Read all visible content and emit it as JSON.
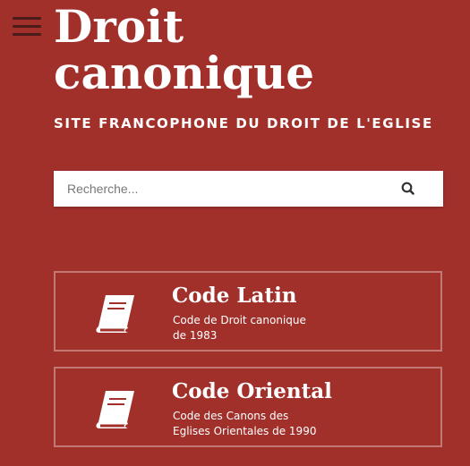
{
  "header": {
    "title_line1": "Droit",
    "title_line2": "canonique",
    "subtitle": "SITE FRANCOPHONE DU DROIT DE L'EGLISE",
    "menu_icon": "hamburger-icon"
  },
  "search": {
    "placeholder": "Recherche...",
    "value": "",
    "icon": "search-icon"
  },
  "cards": [
    {
      "title": "Code Latin",
      "desc_line1": "Code de Droit canonique",
      "desc_line2": "de 1983",
      "icon": "book-icon"
    },
    {
      "title": "Code Oriental",
      "desc_line1": "Code des Canons des",
      "desc_line2": "Eglises Orientales de 1990",
      "icon": "book-icon"
    }
  ],
  "colors": {
    "background": "#a1302b",
    "menu_icon": "#4a1b18",
    "text": "#ffffff",
    "search_bg": "#ffffff"
  }
}
